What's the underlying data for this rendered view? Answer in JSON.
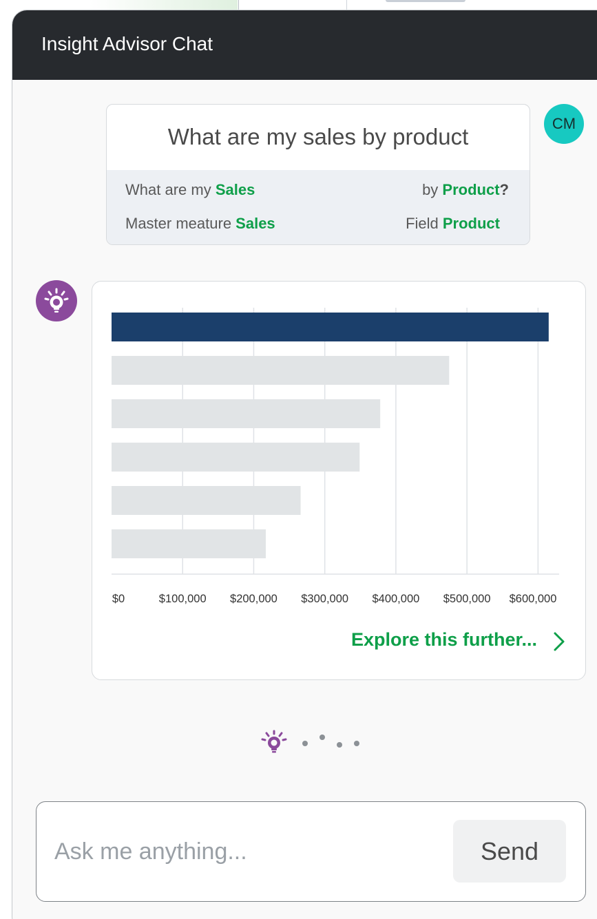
{
  "window": {
    "title": "Insight Advisor Chat"
  },
  "query": {
    "text": "What are my sales by product",
    "row1": {
      "left_prefix": "What are my ",
      "left_value": "Sales",
      "right_prefix": "by ",
      "right_value": "Product",
      "right_suffix": "?"
    },
    "row2": {
      "left_prefix": "Master meature ",
      "left_value": "Sales",
      "right_prefix": "Field ",
      "right_value": "Product"
    }
  },
  "user": {
    "initials": "CM"
  },
  "chart_data": {
    "type": "bar",
    "orientation": "horizontal",
    "categories": [],
    "values": [
      615000,
      475000,
      378000,
      349000,
      266000,
      217000
    ],
    "highlight_index": 0,
    "xlim": [
      0,
      620000
    ],
    "ticks": [
      0,
      100000,
      200000,
      300000,
      400000,
      500000,
      600000
    ],
    "tick_labels": [
      "$0",
      "$100,000",
      "$200,000",
      "$300,000",
      "$400,000",
      "$500,000",
      "$600,000"
    ],
    "colors": {
      "highlight": "#1b3f6b",
      "default": "#e1e4e6",
      "grid": "#dfe2e6"
    },
    "grid": true
  },
  "explore_label": "Explore this further...",
  "input": {
    "placeholder": "Ask me anything..."
  },
  "send_label": "Send",
  "icons": {
    "bot": "lightbulb-icon",
    "explore": "chevron-right-icon"
  },
  "colors": {
    "accent": "#0e9f49",
    "titlebar": "#272a2e",
    "bot": "#8b4a9c",
    "avatar": "#17c9c1"
  }
}
